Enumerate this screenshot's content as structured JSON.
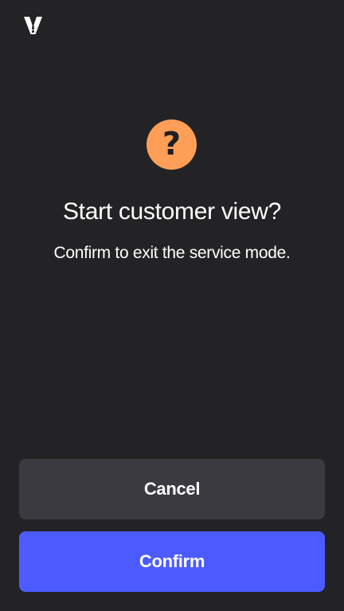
{
  "logo": {
    "icon": "brand-logo-icon"
  },
  "dialog": {
    "icon": "question-icon",
    "icon_glyph": "?",
    "icon_color": "#ff9f57",
    "title": "Start customer view?",
    "message": "Confirm to exit the service mode."
  },
  "actions": {
    "cancel_label": "Cancel",
    "confirm_label": "Confirm"
  },
  "colors": {
    "background": "#232325",
    "cancel_button": "#3a3a40",
    "confirm_button": "#4c5bff",
    "text": "#ffffff"
  }
}
